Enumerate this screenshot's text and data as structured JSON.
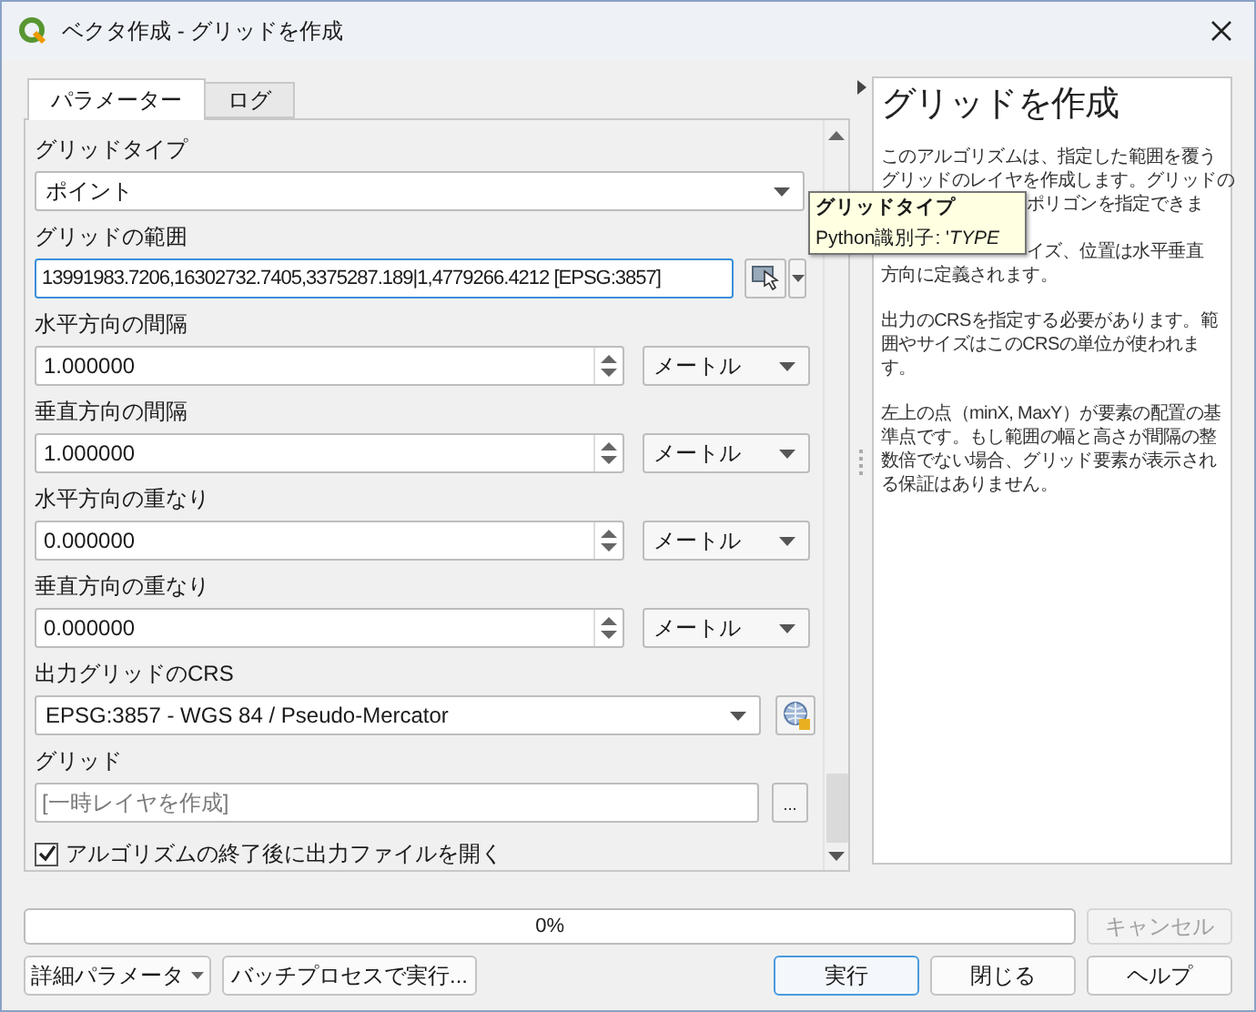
{
  "window": {
    "title": "ベクタ作成 - グリッドを作成"
  },
  "tabs": [
    {
      "label": "パラメーター",
      "selected": true
    },
    {
      "label": "ログ",
      "selected": false
    }
  ],
  "parameters": [
    {
      "kind": "combo",
      "label": "グリッドタイプ",
      "value": "ポイント"
    },
    {
      "kind": "extent",
      "label": "グリッドの範囲",
      "value": "13991983.7206,16302732.7405,3375287.189|1,4779266.4212 [EPSG:3857]",
      "focused": true
    },
    {
      "kind": "number",
      "label": "水平方向の間隔",
      "value": "1.000000",
      "unit": "メートル"
    },
    {
      "kind": "number",
      "label": "垂直方向の間隔",
      "value": "1.000000",
      "unit": "メートル"
    },
    {
      "kind": "number",
      "label": "水平方向の重なり",
      "value": "0.000000",
      "unit": "メートル"
    },
    {
      "kind": "number",
      "label": "垂直方向の重なり",
      "value": "0.000000",
      "unit": "メートル"
    },
    {
      "kind": "crs",
      "label": "出力グリッドのCRS",
      "value": "EPSG:3857 - WGS 84 / Pseudo-Mercator"
    },
    {
      "kind": "file",
      "label": "グリッド",
      "placeholder": "[一時レイヤを作成]",
      "button": "..."
    }
  ],
  "open_output": {
    "label": "アルゴリズムの終了後に出力ファイルを開く",
    "checked": true
  },
  "tooltip": {
    "title": "グリッドタイプ",
    "text": "Python識別子: '*TYPE*"
  },
  "help": {
    "title": "グリッドを作成",
    "lines": [
      {
        "text": "このアルゴリズムは、指定した範囲を覆う",
        "cut": false
      },
      {
        "text": "グリッドのレイヤを作成します。グリッドの",
        "cut": false
      },
      {
        "text": "ポリゴンを指定できま",
        "cut": true
      },
      {
        "text": "イズ、位置は水平垂直",
        "cut": true
      },
      {
        "text": "方向に定義されます。",
        "cut": false
      }
    ],
    "paragraphs": [
      "出力のCRSを指定する必要があります。範囲やサイズはこのCRSの単位が使われます。",
      "左上の点（minX, MaxY）が要素の配置の基準点です。もし範囲の幅と高さが間隔の整数倍でない場合、グリッド要素が表示される保証はありません。"
    ]
  },
  "progress": {
    "level": 0,
    "label": "0%"
  },
  "cancel": {
    "label": "キャンセル",
    "disabled": true
  },
  "advanced": {
    "label": "詳細パラメータ"
  },
  "batch": {
    "label": "バッチプロセスで実行..."
  },
  "buttons": [
    {
      "label": "実行",
      "default": true
    },
    {
      "label": "閉じる",
      "default": false
    },
    {
      "label": "ヘルプ",
      "default": false
    }
  ]
}
